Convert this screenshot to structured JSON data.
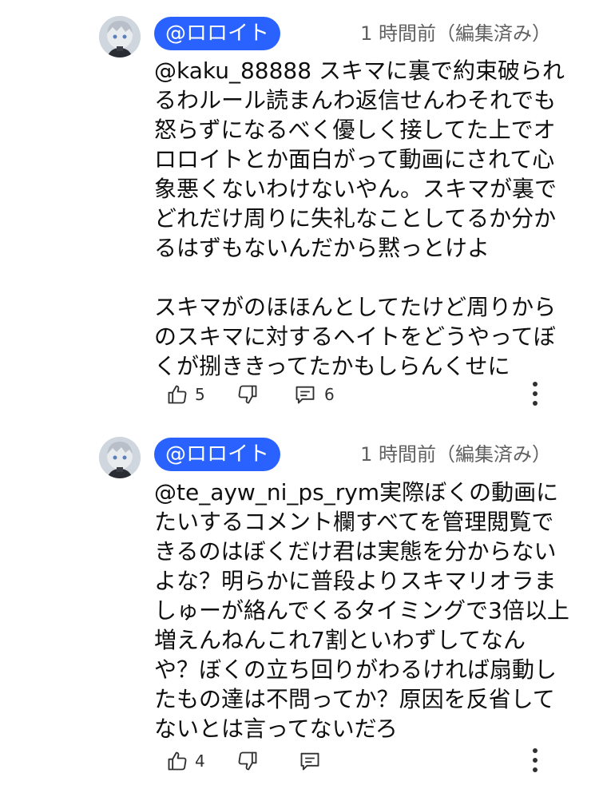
{
  "comments": [
    {
      "handle": "@ロロイト",
      "time": "1 時間前（編集済み）",
      "text": "@kaku_88888 スキマに裏で約束破られるわルール読まんわ返信せんわそれでも怒らずになるべく優しく接してた上でオロロイトとか面白がって動画にされて心象悪くないわけないやん。スキマが裏でどれだけ周りに失礼なことしてるか分かるはずもないんだから黙っとけよ\n\nスキマがのほほんとしてたけど周りからのスキマに対するヘイトをどうやってぼくが捌ききってたかもしらんくせに",
      "likes": "5",
      "replies": "6"
    },
    {
      "handle": "@ロロイト",
      "time": "1 時間前（編集済み）",
      "text": "@te_ayw_ni_ps_rym実際ぼくの動画にたいするコメント欄すべてを管理閲覧できるのはぼくだけ君は実態を分からないよな？明らかに普段よりスキマリオラましゅーが絡んでくるタイミングで3倍以上増えんねんこれ7割といわずしてなんや？ぼくの立ち回りがわるければ扇動したもの達は不問ってか？原因を反省してないとは言ってないだろ",
      "likes": "4",
      "replies": ""
    }
  ],
  "icons": {
    "like": "thumbs-up-icon",
    "dislike": "thumbs-down-icon",
    "reply": "reply-icon",
    "more": "more-vert-icon"
  },
  "colors": {
    "handle_bg": "#2962ff",
    "muted": "#606060"
  }
}
